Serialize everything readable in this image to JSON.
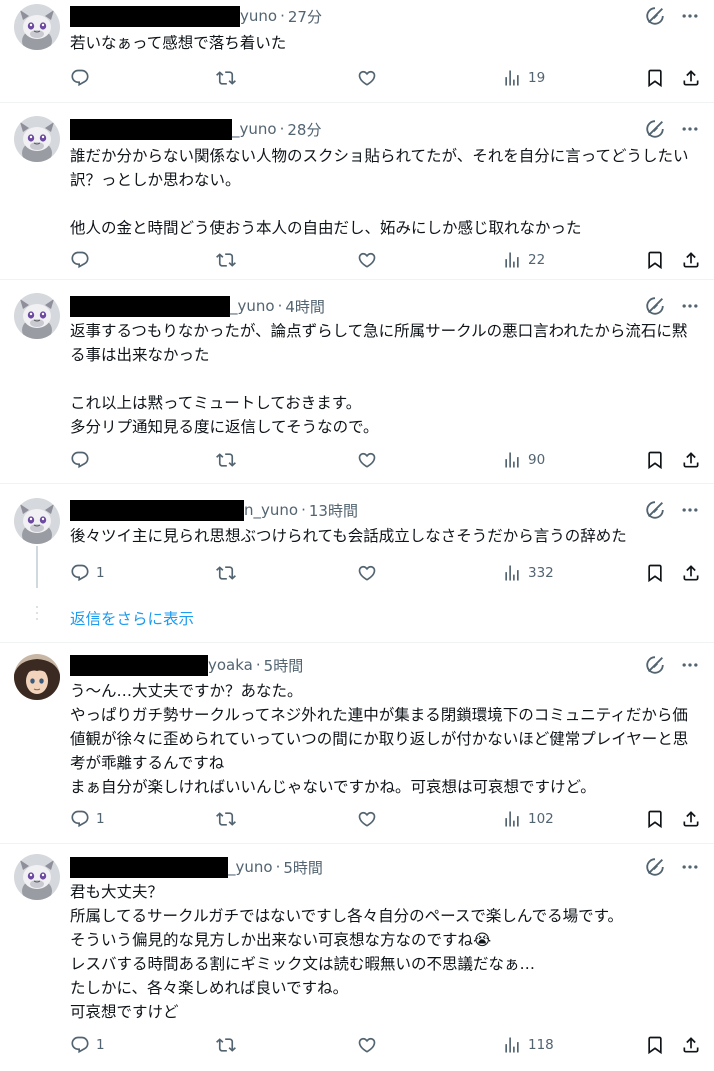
{
  "colors": {
    "accent": "#1d9bf0",
    "text": "#0f1419",
    "muted": "#536471",
    "separator": "#eff3f4"
  },
  "posts": [
    {
      "handle_tail": "yuno",
      "time": "27分",
      "text": "若いなぁって感想で落ち着いた",
      "reply_count": "",
      "views": "19",
      "avatar": "espurr-avatar"
    },
    {
      "handle_tail": "_yuno",
      "time": "28分",
      "text": "誰だか分からない関係ない人物のスクショ貼られてたが、それを自分に言ってどうしたい訳？っとしか思わない。\n\n他人の金と時間どう使おう本人の自由だし、妬みにしか感じ取れなかった",
      "reply_count": "",
      "views": "22",
      "avatar": "espurr-avatar"
    },
    {
      "handle_tail": "_yuno",
      "time": "4時間",
      "text": "返事するつもりなかったが、論点ずらして急に所属サークルの悪口言われたから流石に黙る事は出来なかった\n\nこれ以上は黙ってミュートしておきます。\n多分リプ通知見る度に返信してそうなので。",
      "reply_count": "",
      "views": "90",
      "avatar": "espurr-avatar"
    },
    {
      "handle_tail": "n_yuno",
      "time": "13時間",
      "text": "後々ツイ主に見られ思想ぶつけられても会話成立しなさそうだから言うの辞めた",
      "reply_count": "1",
      "views": "332",
      "avatar": "espurr-avatar"
    },
    {
      "handle_tail": "yoaka",
      "time": "5時間",
      "text": "う〜ん…大丈夫ですか？あなた。\nやっぱりガチ勢サークルってネジ外れた連中が集まる閉鎖環境下のコミュニティだから価値観が徐々に歪められていっていつの間にか取り返しが付かないほど健常プレイヤーと思考が乖離するんですね\nまぁ自分が楽しければいいんじゃないですかね。可哀想は可哀想ですけど。",
      "reply_count": "1",
      "views": "102",
      "avatar": "anime-avatar"
    },
    {
      "handle_tail": "_yuno",
      "time": "5時間",
      "text": "君も大丈夫？\n所属してるサークルガチではないですし各々自分のペースで楽しんでる場です。\nそういう偏見的な見方しか出来ない可哀想な方なのですね😭\nレスバする時間ある割にギミック文は読む暇無いの不思議だなぁ…\nたしかに、各々楽しめれば良いですね。\n可哀想ですけど",
      "reply_count": "1",
      "views": "118",
      "avatar": "espurr-avatar"
    }
  ],
  "show_more_replies": "返信をさらに表示"
}
